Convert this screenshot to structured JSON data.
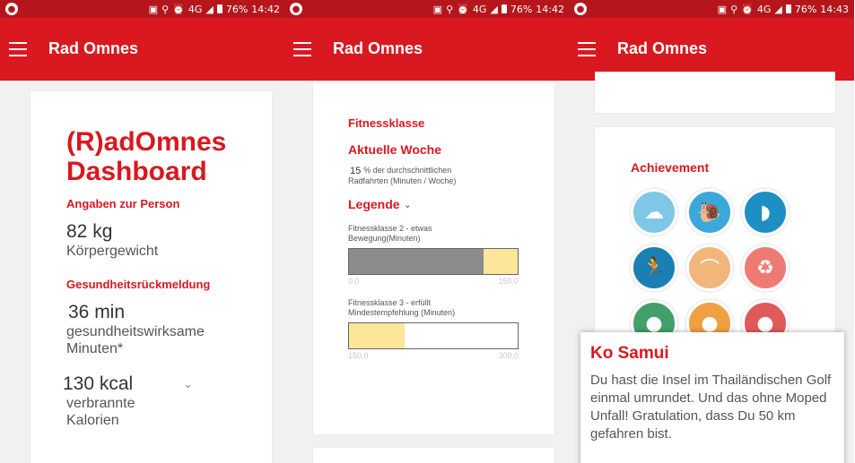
{
  "screens": [
    {
      "status": {
        "net": "4G",
        "battery": "76%",
        "time": "14:42"
      },
      "appbar": {
        "title": "Rad Omnes"
      },
      "dashboard": {
        "title_line1": "(R)adOmnes",
        "title_line2": "Dashboard",
        "person_heading": "Angaben zur Person",
        "weight_value": "82 kg",
        "weight_label": "Körpergewicht",
        "health_heading": "Gesundheitsrückmeldung",
        "minutes_value": "36 min",
        "minutes_label_line1": "gesundheitswirksame",
        "minutes_label_line2": "Minuten*",
        "kcal_value": "130 kcal",
        "kcal_label_line1": "verbrannte",
        "kcal_label_line2": "Kalorien"
      }
    },
    {
      "status": {
        "net": "4G",
        "battery": "76%",
        "time": "14:42"
      },
      "appbar": {
        "title": "Rad Omnes"
      },
      "fitness": {
        "heading": "Fitnessklasse",
        "week_heading": "Aktuelle Woche",
        "percent": "15",
        "percent_text_line1": "% der durchschnittlichen",
        "percent_text_line2": "Radfahrten (Minuten / Woche)",
        "legend_label": "Legende",
        "class2_line1": "Fitnessklasse 2 - etwas",
        "class2_line2": "Bewegung(Minuten)",
        "class2_min": "0,0",
        "class2_max": "150,0",
        "class2_gray_fraction": 0.8,
        "class2_yellow_fraction": 0.2,
        "class3_line1": "Fitnessklasse 3 - erfüllt",
        "class3_line2": "Mindestempfehlung (Minuten)",
        "class3_min": "150,0",
        "class3_max": "300,0",
        "class3_yellow_fraction": 0.33
      }
    },
    {
      "status": {
        "net": "4G",
        "battery": "76%",
        "time": "14:43"
      },
      "appbar": {
        "title": "Rad Omnes"
      },
      "achievement": {
        "heading": "Achievement",
        "badges": [
          {
            "icon": "cloud-icon",
            "color": "#7fc7e6"
          },
          {
            "icon": "snail-icon",
            "color": "#3aa8d8"
          },
          {
            "icon": "seal-icon",
            "color": "#1e8fc3"
          },
          {
            "icon": "runner-icon",
            "color": "#1a7fb3"
          },
          {
            "icon": "bridge-icon",
            "color": "#f2b57a"
          },
          {
            "icon": "recycle-icon",
            "color": "#ee7b73"
          },
          {
            "icon": "badge-green-icon",
            "color": "#43a06a"
          },
          {
            "icon": "badge-orange-icon",
            "color": "#f0a040"
          },
          {
            "icon": "badge-red-icon",
            "color": "#e15a5a"
          }
        ]
      },
      "popup": {
        "title": "Ko Samui",
        "text": "Du hast die Insel im Thailändischen Golf einmal umrundet. Und das ohne Moped Unfall! Gratulation, dass Du 50 km gefahren bist."
      }
    }
  ],
  "colors": {
    "brand_red": "#d9181f",
    "status_red": "#b5161c",
    "bar_gray": "#8c8c8c",
    "bar_yellow": "#fde59a"
  }
}
